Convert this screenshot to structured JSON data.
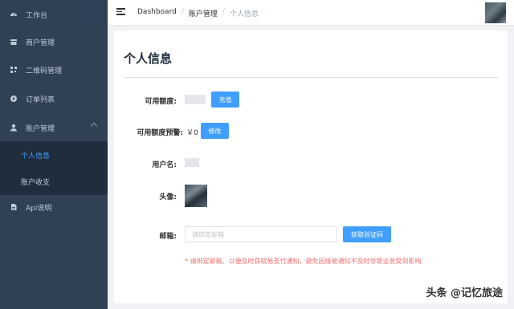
{
  "sidebar": {
    "items": [
      {
        "label": "工作台",
        "icon": "dashboard-icon"
      },
      {
        "label": "商户管理",
        "icon": "shop-icon"
      },
      {
        "label": "二维码管理",
        "icon": "qrcode-icon"
      },
      {
        "label": "订单列表",
        "icon": "order-icon"
      },
      {
        "label": "账户管理",
        "icon": "user-icon",
        "expanded": true,
        "children": [
          {
            "label": "个人信息",
            "active": true
          },
          {
            "label": "账户收支"
          }
        ]
      },
      {
        "label": "Api说明",
        "icon": "document-icon"
      }
    ]
  },
  "header": {
    "breadcrumb": [
      "Dashboard",
      "账户管理",
      "个人信息"
    ]
  },
  "profile": {
    "title": "个人信息",
    "balance_label": "可用额度:",
    "recharge_button": "充值",
    "warning_label": "可用额度预警:",
    "warning_value": "￥0",
    "modify_button": "修改",
    "username_label": "用户名:",
    "avatar_label": "头像:",
    "email_label": "邮箱:",
    "email_placeholder": "请绑定邮箱",
    "get_code_button": "获取验证码",
    "email_notice": "* 请绑定邮箱，以便及时获取易支付通知，避免因接收通知不及时导致业务受到影响"
  },
  "watermark": "头条 @记忆旅途",
  "colors": {
    "sidebar_bg": "#304156",
    "submenu_bg": "#1f2d3d",
    "primary": "#409eff",
    "danger": "#f56c6c"
  }
}
